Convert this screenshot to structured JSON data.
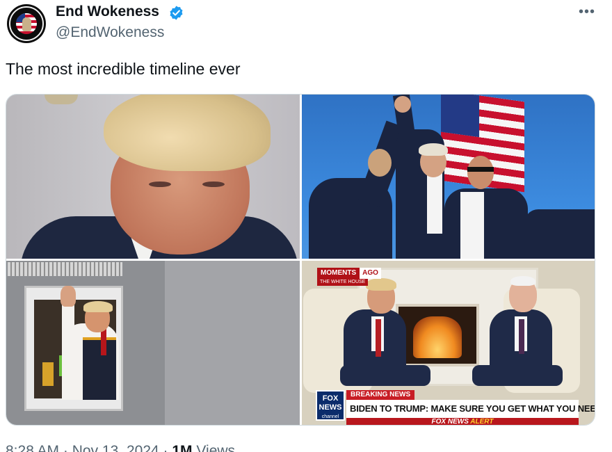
{
  "author": {
    "display_name": "End Wokeness",
    "handle": "@EndWokeness",
    "verified": true,
    "avatar_icon": "avatar-badge-icon",
    "accent_color": "#1d9bf0"
  },
  "menu": {
    "more_label": "•••"
  },
  "tweet": {
    "text": "The most incredible timeline ever"
  },
  "media": {
    "photos": [
      {
        "name": "mugshot-photo"
      },
      {
        "name": "rally-photo"
      },
      {
        "name": "drive-thru-photo"
      },
      {
        "name": "oval-office-photo",
        "overlay": {
          "moments": "MOMENTS",
          "ago": "AGO",
          "source": "THE WHITE HOUSE",
          "logo_top": "FOX",
          "logo_mid": "NEWS",
          "logo_bottom": "channel",
          "breaking": "BREAKING NEWS",
          "headline": "BIDEN TO TRUMP: MAKE SURE YOU GET WHAT YOU NEED",
          "alert_brand": "FOX NEWS",
          "alert_word": "ALERT"
        }
      }
    ]
  },
  "meta": {
    "time": "8:28 AM",
    "separator": "·",
    "date": "Nov 13, 2024",
    "views_count": "1M",
    "views_label": "Views"
  }
}
